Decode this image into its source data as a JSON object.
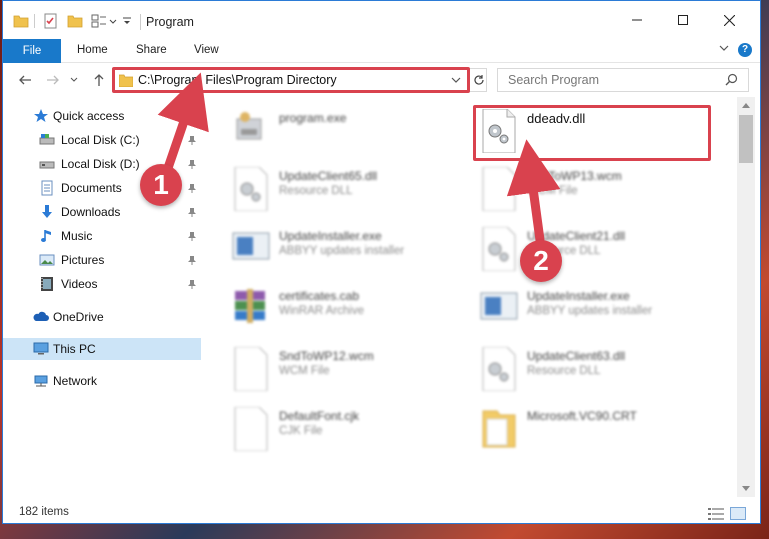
{
  "window": {
    "title": "Program",
    "controls": [
      "minimize",
      "maximize",
      "close"
    ]
  },
  "ribbon": {
    "tabs": [
      "File",
      "Home",
      "Share",
      "View"
    ],
    "help": "?"
  },
  "address": {
    "path": "C:\\Program Files\\Program Directory",
    "search_placeholder": "Search Program"
  },
  "sidebar": {
    "items": [
      {
        "label": "Quick access",
        "icon": "star-icon",
        "pinned": false
      },
      {
        "label": "Local Disk (C:)",
        "icon": "drive-icon",
        "pinned": true
      },
      {
        "label": "Local Disk (D:)",
        "icon": "drive-icon",
        "pinned": true
      },
      {
        "label": "Documents",
        "icon": "documents-icon",
        "pinned": true
      },
      {
        "label": "Downloads",
        "icon": "downloads-icon",
        "pinned": true
      },
      {
        "label": "Music",
        "icon": "music-icon",
        "pinned": true
      },
      {
        "label": "Pictures",
        "icon": "pictures-icon",
        "pinned": true
      },
      {
        "label": "Videos",
        "icon": "videos-icon",
        "pinned": true
      },
      {
        "label": "OneDrive",
        "icon": "onedrive-icon",
        "pinned": false
      },
      {
        "label": "This PC",
        "icon": "computer-icon",
        "pinned": false,
        "selected": true
      },
      {
        "label": "Network",
        "icon": "network-icon",
        "pinned": false
      }
    ]
  },
  "files": [
    {
      "name": "program.exe",
      "type": "",
      "icon": "exe-icon"
    },
    {
      "name": "ddeadv.dll",
      "type": "",
      "icon": "dll-gear-icon"
    },
    {
      "name": "UpdateClient65.dll",
      "type": "Resource DLL",
      "icon": "dll-gear-icon"
    },
    {
      "name": "SndToWP13.wcm",
      "type": "WCM File",
      "icon": "blank-file-icon"
    },
    {
      "name": "UpdateInstaller.exe",
      "type": "ABBYY updates installer",
      "icon": "installer-icon"
    },
    {
      "name": "UpdateClient21.dll",
      "type": "Resource DLL",
      "icon": "dll-gear-icon"
    },
    {
      "name": "certificates.cab",
      "type": "WinRAR Archive",
      "icon": "winrar-icon"
    },
    {
      "name": "UpdateInstaller.exe",
      "type": "ABBYY updates installer",
      "icon": "installer-icon"
    },
    {
      "name": "SndToWP12.wcm",
      "type": "WCM File",
      "icon": "blank-file-icon"
    },
    {
      "name": "UpdateClient63.dll",
      "type": "Resource DLL",
      "icon": "dll-gear-icon"
    },
    {
      "name": "DefaultFont.cjk",
      "type": "CJK File",
      "icon": "blank-file-icon"
    },
    {
      "name": "Microsoft.VC90.CRT",
      "type": "",
      "icon": "folder-icon"
    }
  ],
  "status": {
    "items_count": "182 items"
  },
  "annotations": {
    "step1": "1",
    "step2": "2",
    "accent": "#d9424e"
  }
}
